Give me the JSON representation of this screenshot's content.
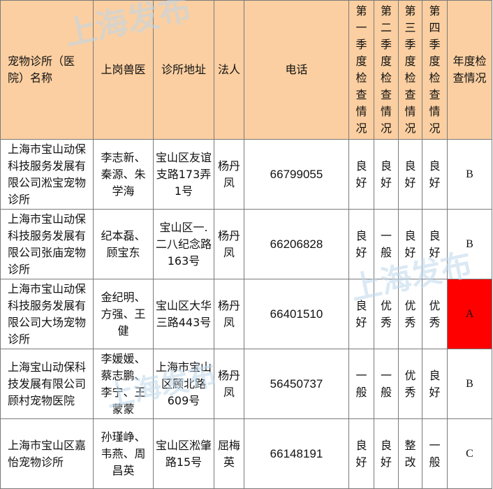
{
  "headers": {
    "name": "宠物诊所（医院）名称",
    "vet": "上岗兽医",
    "address": "诊所地址",
    "legal": "法人",
    "phone": "电话",
    "q1": "第一季度检查情况",
    "q2": "第二季度检查情况",
    "q3": "第三季度检查情况",
    "q4": "第四季度检查情况",
    "annual": "年度检查情况"
  },
  "rows": [
    {
      "name": "上海市宝山动保科技服务发展有限公司淞宝宠物诊所",
      "vets": "李志新、秦源、朱学海",
      "address": "宝山区友谊支路173弄1号",
      "legal": "杨丹凤",
      "phone": "66799055",
      "q1": "良好",
      "q2": "良好",
      "q3": "良好",
      "q4": "良好",
      "annual": "B"
    },
    {
      "name": "上海市宝山动保科技服务发展有限公司张庙宠物诊所",
      "vets": "纪本磊、顾宝东",
      "address": "宝山区一.二八纪念路163号",
      "legal": "杨丹凤",
      "phone": "66206828",
      "q1": "良好",
      "q2": "一般",
      "q3": "良好",
      "q4": "良好",
      "annual": "B"
    },
    {
      "name": "上海市宝山动保科技服务发展有限公司大场宠物诊所",
      "vets": "金纪明、方强、王健",
      "address": "宝山区大华三路443号",
      "legal": "杨丹凤",
      "phone": "66401510",
      "q1": "良好",
      "q2": "优秀",
      "q3": "优秀",
      "q4": "优秀",
      "annual": "A"
    },
    {
      "name": "上海宝山动保科技发展有限公司顾村宠物医院",
      "vets": "李媛媛、蔡志鹏、李宁、王蒙蒙",
      "address": "上海市宝山区顾北路609号",
      "legal": "杨丹凤",
      "phone": "56450737",
      "q1": "一般",
      "q2": "一般",
      "q3": "优秀",
      "q4": "良好",
      "annual": "B"
    },
    {
      "name": "上海市宝山区嘉怡宠物诊所",
      "vets": "孙瑾峥、韦燕、周昌英",
      "address": "宝山区淞肇路15号",
      "legal": "屈梅英",
      "phone": "66148191",
      "q1": "良好",
      "q2": "良好",
      "q3": "整改",
      "q4": "一般",
      "annual": "C"
    }
  ],
  "watermark": "上海发布",
  "colors": {
    "header_bg": "#fbcfa1",
    "grade_a_bg": "#ff0000",
    "border": "#7a7a7a"
  }
}
